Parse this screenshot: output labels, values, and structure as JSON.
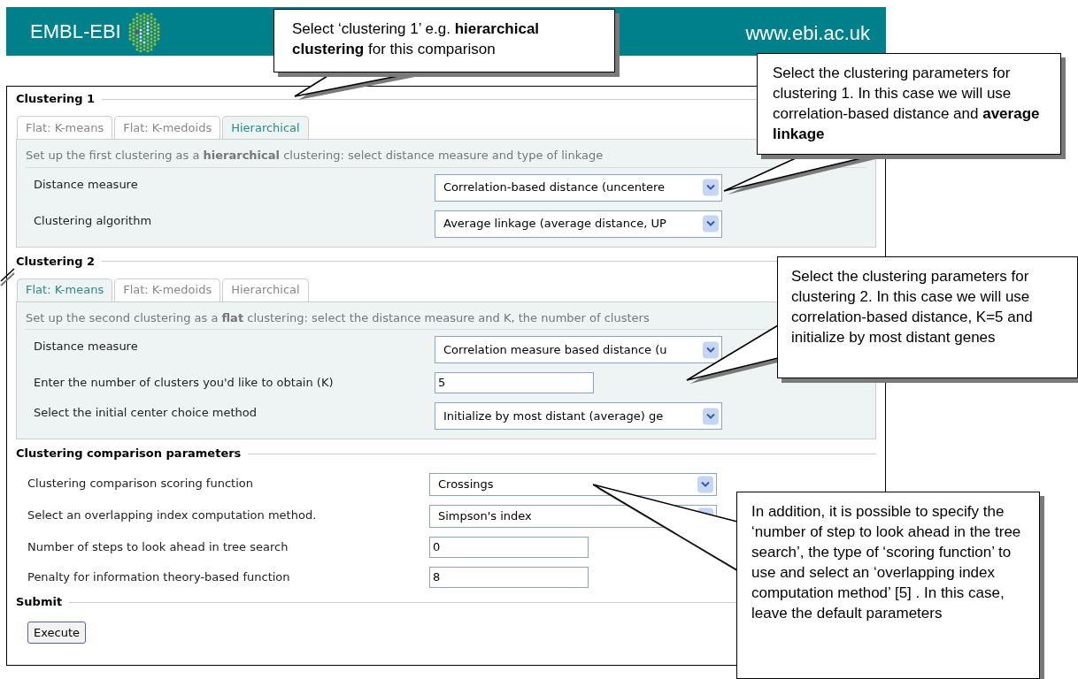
{
  "header": {
    "logo": "EMBL-EBI",
    "url": "www.ebi.ac.uk"
  },
  "sections": [
    {
      "kind": "tabs",
      "title": "Clustering 1",
      "tabs": [
        {
          "label": "Flat: K-means",
          "selected": false
        },
        {
          "label": "Flat: K-medoids",
          "selected": false
        },
        {
          "label": "Hierarchical",
          "selected": true
        }
      ],
      "description": "Set up the first clustering as a **hierarchical** clustering: select distance measure and type of linkage",
      "fields": [
        {
          "kind": "select",
          "label": "Distance measure",
          "value": "Correlation-based distance (uncentere"
        },
        {
          "kind": "select",
          "label": "Clustering algorithm",
          "value": "Average linkage (average distance, UP"
        }
      ]
    },
    {
      "kind": "tabs",
      "title": "Clustering 2",
      "tabs": [
        {
          "label": "Flat: K-means",
          "selected": true
        },
        {
          "label": "Flat: K-medoids",
          "selected": false
        },
        {
          "label": "Hierarchical",
          "selected": false
        }
      ],
      "description": "Set up the second clustering as a **flat** clustering: select the distance measure and K, the number of clusters",
      "fields": [
        {
          "kind": "select",
          "label": "Distance measure",
          "value": "Correlation measure based distance (u"
        },
        {
          "kind": "input",
          "label": "Enter the number of clusters you'd like to obtain (K)",
          "value": "5"
        },
        {
          "kind": "select",
          "label": "Select the initial center choice method",
          "value": "Initialize by most distant (average) ge"
        }
      ]
    },
    {
      "kind": "plain",
      "title": "Clustering comparison parameters",
      "fields": [
        {
          "kind": "select",
          "label": "Clustering comparison scoring function",
          "value": "Crossings"
        },
        {
          "kind": "select",
          "label": "Select an overlapping index computation method.",
          "value": "Simpson's index"
        },
        {
          "kind": "input",
          "label": "Number of steps to look ahead in tree search",
          "value": "0"
        },
        {
          "kind": "input",
          "label": "Penalty for information theory-based function",
          "value": "8"
        }
      ]
    },
    {
      "kind": "submit",
      "title": "Submit",
      "button": "Execute"
    }
  ],
  "callouts": [
    {
      "text": "Select ‘clustering 1’ e.g. **hierarchical clustering** for this comparison"
    },
    {
      "text": "Select the clustering parameters for clustering 1. In this case we will use correlation-based distance and **average linkage**"
    },
    {
      "text": "Select the clustering parameters for clustering 2. In this case we will use correlation-based distance, K=5 and initialize by most distant genes"
    },
    {
      "text": "In addition, it is possible to specify the ‘number of step to look ahead in the tree search’, the type of ‘scoring function’ to use and select an ‘overlapping index computation method’ [5] . In this case, leave the default parameters"
    }
  ]
}
